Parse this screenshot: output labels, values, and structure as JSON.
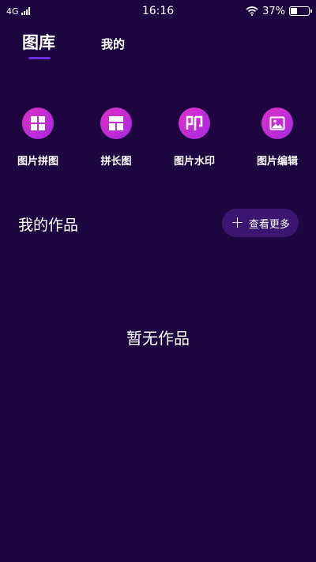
{
  "status_bar": {
    "network": "4G",
    "time": "16:16",
    "battery": "37%",
    "battery_level": 0.37
  },
  "tabs": [
    {
      "label": "图库",
      "active": true
    },
    {
      "label": "我的",
      "active": false
    }
  ],
  "tools": [
    {
      "label": "图片拼图",
      "icon": "collage-icon"
    },
    {
      "label": "拼长图",
      "icon": "long-image-icon"
    },
    {
      "label": "图片水印",
      "icon": "watermark-icon",
      "glyph": "印"
    },
    {
      "label": "图片编辑",
      "icon": "image-edit-icon"
    }
  ],
  "works": {
    "title": "我的作品",
    "more_label": "查看更多",
    "more_icon": "plus-icon",
    "empty_text": "暂无作品"
  },
  "colors": {
    "background": "#1e0640",
    "accent": "#6a2ee8",
    "icon_gradient_start": "#e02fc8",
    "icon_gradient_end": "#a52ae0",
    "button_bg": "#3a1670"
  }
}
